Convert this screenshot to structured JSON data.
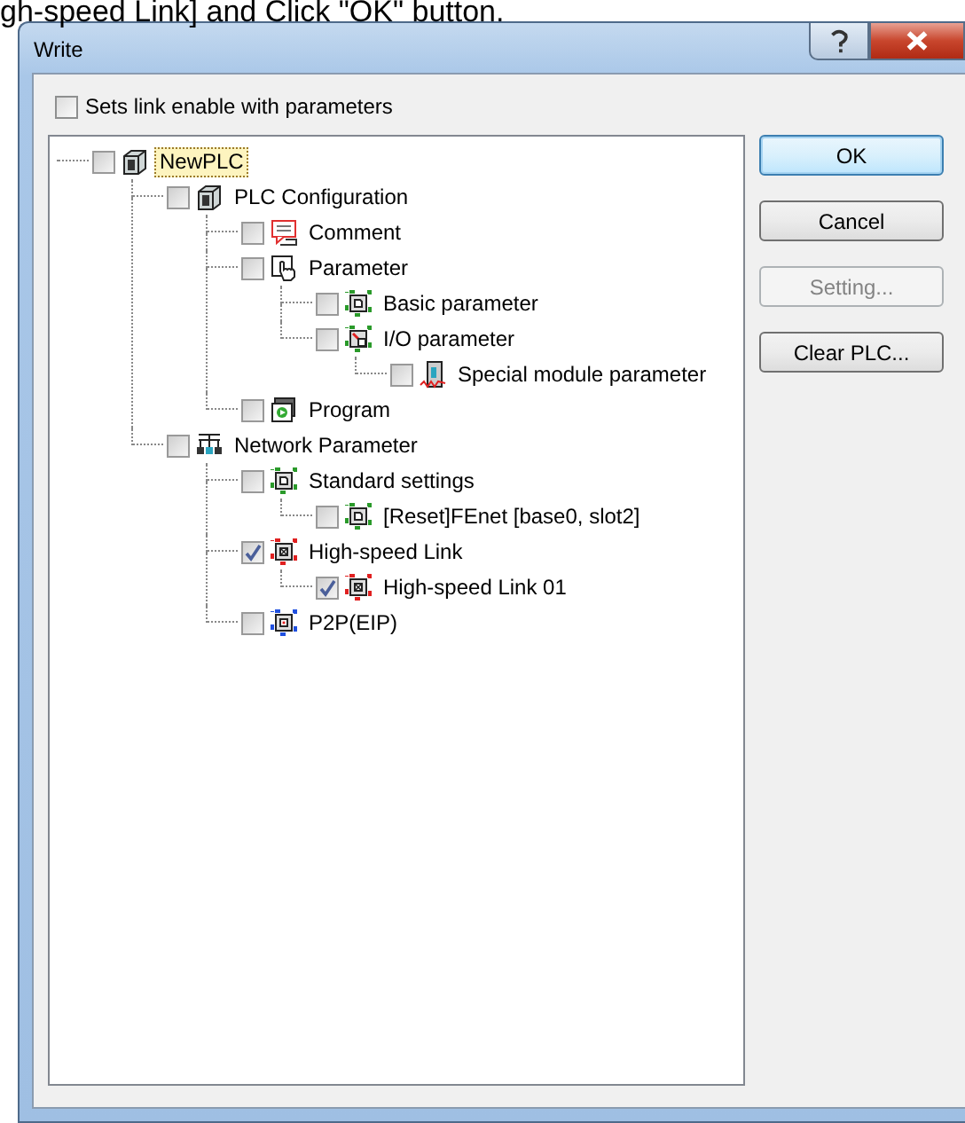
{
  "caption": "gh-speed Link] and Click \"OK\" button.",
  "window": {
    "title": "Write"
  },
  "option": {
    "label": "Sets link enable with parameters",
    "checked": false
  },
  "tree": [
    {
      "label": "NewPLC",
      "kind": "device",
      "checked": false,
      "selected": true,
      "children": [
        {
          "label": "PLC Configuration",
          "kind": "device",
          "checked": false,
          "selected": false,
          "children": [
            {
              "label": "Comment",
              "kind": "comment",
              "checked": false,
              "selected": false
            },
            {
              "label": "Parameter",
              "kind": "hand",
              "checked": false,
              "selected": false,
              "children": [
                {
                  "label": "Basic parameter",
                  "kind": "param-green",
                  "checked": false,
                  "selected": false
                },
                {
                  "label": "I/O parameter",
                  "kind": "io",
                  "checked": false,
                  "selected": false,
                  "children": [
                    {
                      "label": "Special module parameter",
                      "kind": "module",
                      "checked": false,
                      "selected": false
                    }
                  ]
                }
              ]
            },
            {
              "label": "Program",
              "kind": "program",
              "checked": false,
              "selected": false
            }
          ]
        },
        {
          "label": "Network Parameter",
          "kind": "network",
          "checked": false,
          "selected": false,
          "children": [
            {
              "label": "Standard settings",
              "kind": "param-green",
              "checked": false,
              "selected": false,
              "children": [
                {
                  "label": "[Reset]FEnet [base0, slot2]",
                  "kind": "param-green",
                  "checked": false,
                  "selected": false
                }
              ]
            },
            {
              "label": "High-speed Link",
              "kind": "param-red",
              "checked": true,
              "selected": false,
              "children": [
                {
                  "label": "High-speed Link 01",
                  "kind": "param-red",
                  "checked": true,
                  "selected": false
                }
              ]
            },
            {
              "label": "P2P(EIP)",
              "kind": "param-blue",
              "checked": false,
              "selected": false
            }
          ]
        }
      ]
    }
  ],
  "buttons": [
    {
      "label": "OK",
      "default": true,
      "disabled": false
    },
    {
      "label": "Cancel",
      "default": false,
      "disabled": false
    },
    {
      "label": "Setting...",
      "default": false,
      "disabled": true
    },
    {
      "label": "Clear PLC...",
      "default": false,
      "disabled": false
    }
  ]
}
